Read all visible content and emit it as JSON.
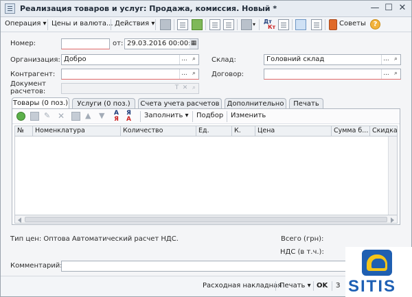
{
  "window": {
    "title": "Реализация товаров и услуг: Продажа, комиссия. Новый *",
    "controls": {
      "minimize": "—",
      "maximize": "☐",
      "close": "✕"
    }
  },
  "toolbar": {
    "operation": "Операция ▾",
    "prices_currency": "Цены и валюта...",
    "actions": "Действия ▾",
    "tips": "Советы",
    "help": "?",
    "dt_kt_top": "Дт",
    "dt_kt_bottom": "Кт"
  },
  "form": {
    "number_label": "Номер:",
    "number_value": "",
    "date_label": "от:",
    "date_value": "29.03.2016 00:00:00",
    "org_label": "Организация:",
    "org_value": "Добро",
    "warehouse_label": "Склад:",
    "warehouse_value": "Головний склад",
    "counterparty_label": "Контрагент:",
    "counterparty_value": "",
    "contract_label": "Договор:",
    "contract_value": "",
    "settlement_label_1": "Документ",
    "settlement_label_2": "расчетов:",
    "field_buttons": {
      "dots": "...",
      "search": "🔍",
      "clear": "✕",
      "type": "T"
    }
  },
  "tabs": [
    {
      "label": "Товары (0 поз.)",
      "active": true
    },
    {
      "label": "Услуги (0 поз.)",
      "active": false
    },
    {
      "label": "Счета учета расчетов",
      "active": false
    },
    {
      "label": "Дополнительно",
      "active": false
    },
    {
      "label": "Печать",
      "active": false
    }
  ],
  "table_toolbar": {
    "fill": "Заполнить ▾",
    "select": "Подбор",
    "change": "Изменить",
    "sort_asc_top": "А",
    "sort_asc_bottom": "Я",
    "sort_desc_top": "Я",
    "sort_desc_bottom": "А"
  },
  "table": {
    "columns": [
      "№",
      "Номенклатура",
      "Количество",
      "Ед.",
      "К.",
      "Цена",
      "Сумма б...",
      "Скидка"
    ],
    "rows": []
  },
  "summary": {
    "price_type": "Тип цен: Оптова Автоматический расчет НДС.",
    "total_label": "Всего (грн):",
    "vat_label": "НДС (в т.ч.):"
  },
  "comment": {
    "label": "Комментарий:",
    "value": ""
  },
  "bottom_bar": {
    "invoice": "Расходная накладная",
    "print": "Печать ▾",
    "ok": "OK",
    "close_partial": "З"
  },
  "logo": {
    "text": "SITIS"
  },
  "colors": {
    "accent": "#1f5fb1",
    "logo_yellow": "#f4c51a",
    "required_underline": "#e26a6a"
  }
}
